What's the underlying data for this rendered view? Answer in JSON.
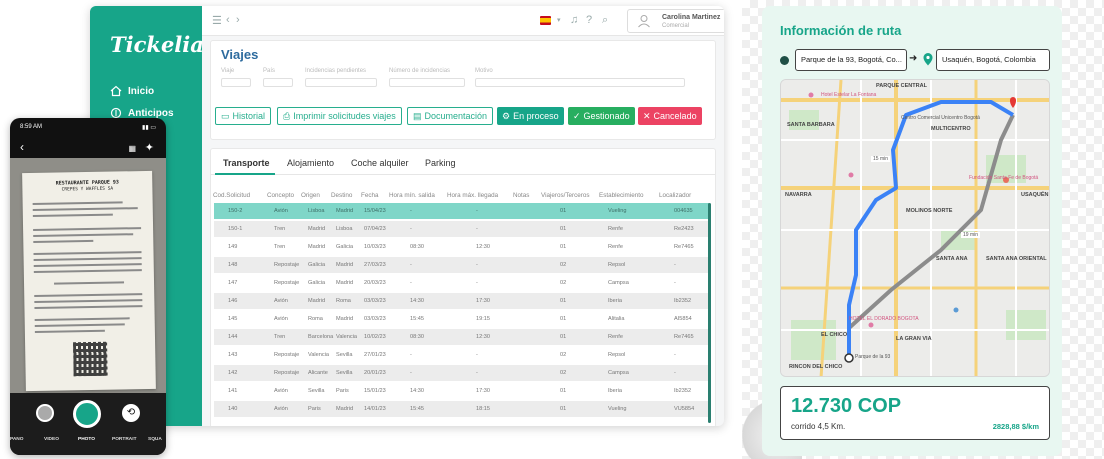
{
  "app": {
    "brand": "Tickelia",
    "sidebar": {
      "items": [
        {
          "label": "Inicio",
          "icon": "home-icon"
        },
        {
          "label": "Anticipos",
          "icon": "money-icon"
        }
      ]
    },
    "user": {
      "name": "Carolina Martinez",
      "role": "Comercial"
    },
    "page_title": "Viajes",
    "filters": [
      {
        "label": "Viaje",
        "value": ""
      },
      {
        "label": "País",
        "value": ""
      },
      {
        "label": "Incidencias pendientes",
        "value": ""
      },
      {
        "label": "Número de incidencias",
        "value": ""
      },
      {
        "label": "Motivo",
        "value": ""
      }
    ],
    "buttons": {
      "historial": "Historial",
      "imprimir": "Imprimir solicitudes viajes",
      "documentacion": "Documentación",
      "en_proceso": "En proceso",
      "gestionado": "Gestionado",
      "cancelado": "Cancelado"
    },
    "tabs": [
      "Transporte",
      "Alojamiento",
      "Coche alquiler",
      "Parking"
    ],
    "columns": [
      "Cod.Solicitud",
      "Concepto",
      "Origen",
      "Destino",
      "Fecha",
      "Hora mín. salida",
      "Hora máx. llegada",
      "Notas",
      "Viajeros/Terceros",
      "Establecimiento",
      "Localizador"
    ],
    "rows": [
      [
        "150-2",
        "Avión",
        "Lisboa",
        "Madrid",
        "15/04/23",
        "-",
        "-",
        "",
        "01",
        "Vueling",
        "004635"
      ],
      [
        "150-1",
        "Tren",
        "Madrid",
        "Lisboa",
        "07/04/23",
        "-",
        "-",
        "",
        "01",
        "Renfe",
        "Re2423"
      ],
      [
        "149",
        "Tren",
        "Madrid",
        "Galicia",
        "10/03/23",
        "08:30",
        "12:30",
        "",
        "01",
        "Renfe",
        "Re7465"
      ],
      [
        "148",
        "Repostaje",
        "Galicia",
        "Madrid",
        "27/03/23",
        "-",
        "-",
        "",
        "02",
        "Repsol",
        "-"
      ],
      [
        "147",
        "Repostaje",
        "Galicia",
        "Madrid",
        "20/03/23",
        "-",
        "-",
        "",
        "02",
        "Campsa",
        "-"
      ],
      [
        "146",
        "Avión",
        "Madrid",
        "Roma",
        "03/03/23",
        "14:30",
        "17:30",
        "",
        "01",
        "Iberia",
        "Ib2352"
      ],
      [
        "145",
        "Avión",
        "Roma",
        "Madrid",
        "03/03/23",
        "15:45",
        "19:15",
        "",
        "01",
        "Alitalia",
        "AI5854"
      ],
      [
        "144",
        "Tren",
        "Barcelona",
        "Valencia",
        "10/02/23",
        "08:30",
        "12:30",
        "",
        "01",
        "Renfe",
        "Re7465"
      ],
      [
        "143",
        "Repostaje",
        "Valencia",
        "Sevilla",
        "27/01/23",
        "-",
        "-",
        "",
        "02",
        "Repsol",
        "-"
      ],
      [
        "142",
        "Repostaje",
        "Alicante",
        "Sevilla",
        "20/01/23",
        "-",
        "-",
        "",
        "02",
        "Campsa",
        "-"
      ],
      [
        "141",
        "Avión",
        "Sevilla",
        "Paris",
        "15/01/23",
        "14:30",
        "17:30",
        "",
        "01",
        "Iberia",
        "Ib2352"
      ],
      [
        "140",
        "Avión",
        "Paris",
        "Madrid",
        "14/01/23",
        "15:45",
        "18:15",
        "",
        "01",
        "Vueling",
        "VU5854"
      ]
    ]
  },
  "phone": {
    "time": "8:59 AM",
    "receipt_title": "RESTAURANTE PARQUE 93",
    "receipt_subtitle": "CREPES Y WAFFLES SA",
    "modes": [
      "PANO",
      "VIDEO",
      "PHOTO",
      "PORTRAIT",
      "SQUA"
    ],
    "active_mode": "PHOTO"
  },
  "route": {
    "title": "Información de ruta",
    "origin": "Parque de la 93, Bogotá, Co...",
    "destination": "Usaquén, Bogotá, Colombia",
    "map_labels": {
      "parque_central": "PARQUE CENTRAL",
      "santa_barbara": "SANTA BARBARA",
      "multicentro": "MULTICENTRO",
      "usaquen": "USAQUÉN",
      "navarra": "NAVARRA",
      "molinos_norte": "MOLINOS NORTE",
      "santa_ana": "SANTA ANA",
      "santa_ana_oriental": "SANTA ANA ORIENTAL",
      "el_chico": "EL CHICO",
      "la_gran_via": "LA GRAN VIA",
      "rincon": "RINCON DEL CHICO",
      "hotel": "HOTEL EL DORADO BOGOTA",
      "parque93": "Parque de la 93",
      "fundacion": "Fundación Santa Fe de Bogotá",
      "unicentro": "Centro Comercial Unicentro Bogotá",
      "hotel_fontana": "Hotel Estelar La Fontana",
      "time_badge_1": "15 min",
      "time_badge_2": "19 min"
    },
    "price": "12.730 COP",
    "distance": "corrido 4,5 Km.",
    "rate": "2828,88 $/km"
  },
  "colors": {
    "brand": "#17a589",
    "selected_row": "#7fd6c8",
    "cancel": "#ec4363",
    "route_blue": "#3b82f6",
    "title_blue": "#2d6b9e"
  }
}
